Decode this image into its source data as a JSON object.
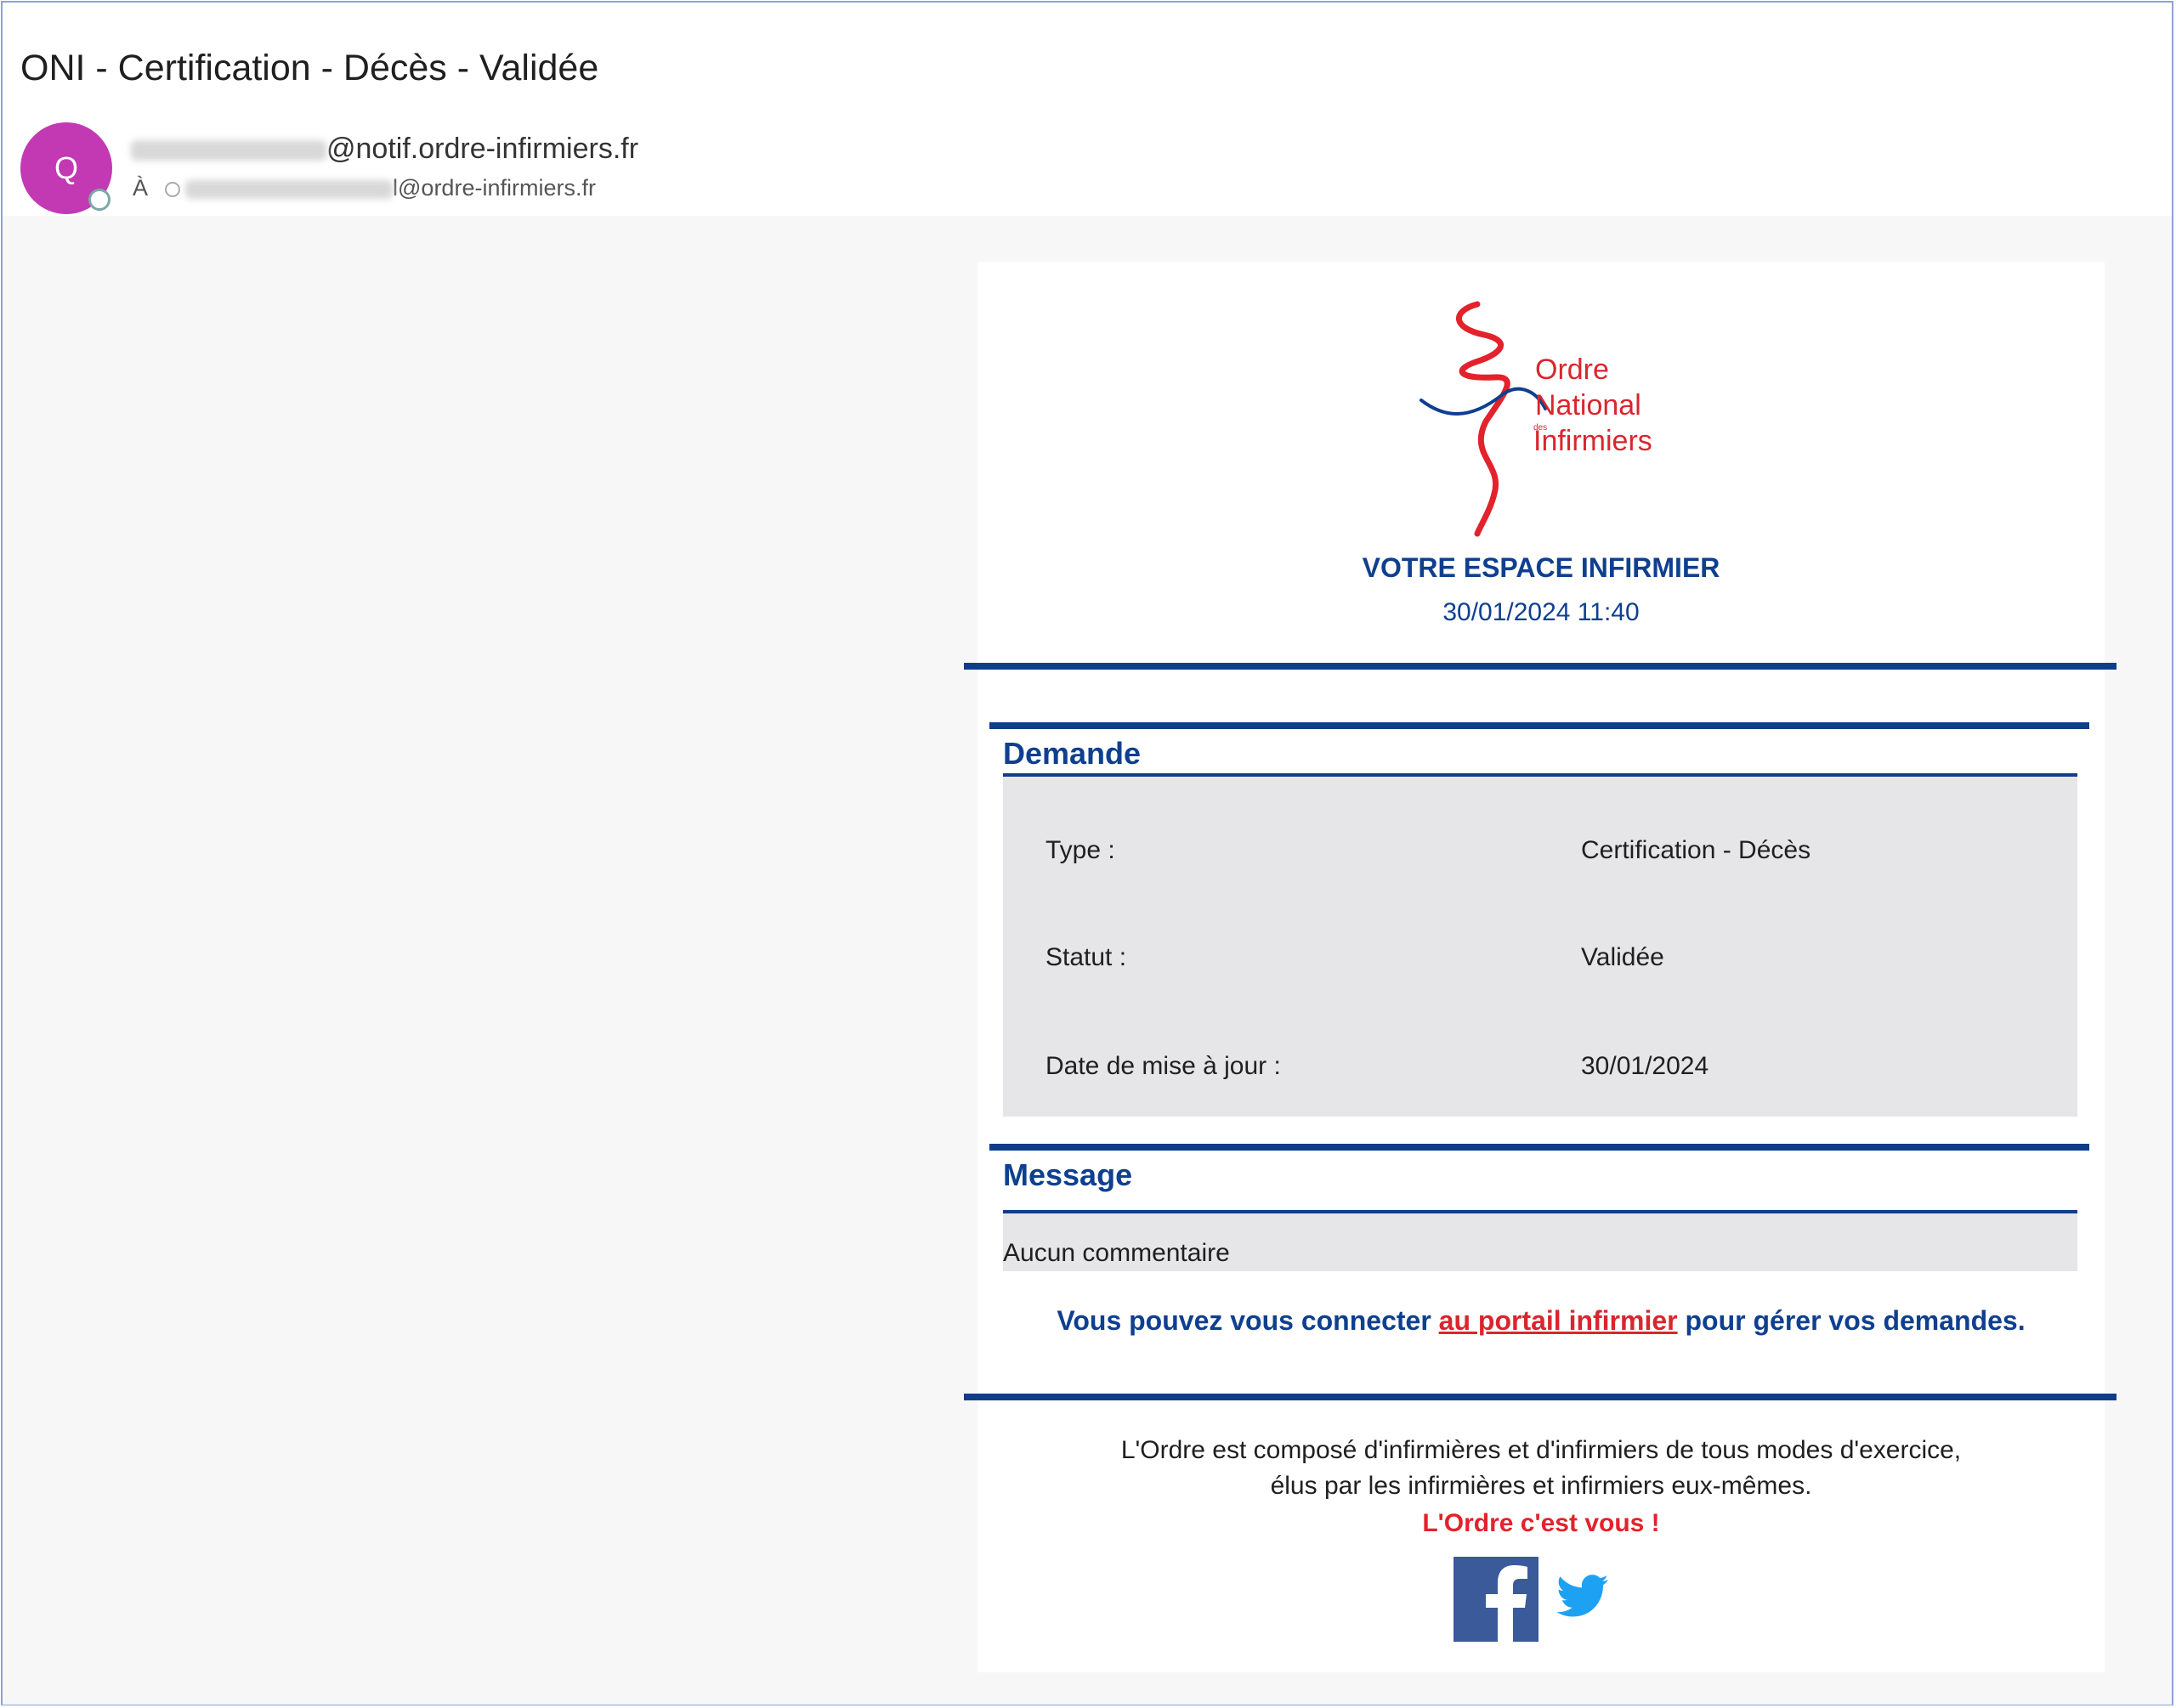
{
  "email": {
    "subject": "ONI - Certification - Décès - Validée",
    "avatar_initial": "Q",
    "sender_domain": "@notif.ordre-infirmiers.fr",
    "to_label": "À",
    "recipient_domain": "l@ordre-infirmiers.fr"
  },
  "header": {
    "logo_text": [
      "Ordre",
      "National",
      "des",
      "Infirmiers"
    ],
    "espace": "VOTRE ESPACE INFIRMIER",
    "datetime": "30/01/2024 11:40"
  },
  "demande": {
    "title": "Demande",
    "rows": [
      {
        "label": "Type :",
        "value": "Certification - Décès"
      },
      {
        "label": "Statut :",
        "value": "Validée"
      },
      {
        "label": "Date de mise à jour :",
        "value": "30/01/2024"
      }
    ]
  },
  "message": {
    "title": "Message",
    "text": "Aucun commentaire"
  },
  "connect": {
    "before": "Vous pouvez vous connecter ",
    "link": "au portail infirmier",
    "after": " pour gérer vos demandes."
  },
  "footer": {
    "line1": "L'Ordre est composé d'infirmières et d'infirmiers de tous modes d'exercice,",
    "line2": "élus par les infirmières et infirmiers eux-mêmes.",
    "tagline": "L'Ordre c'est vous !"
  },
  "colors": {
    "brand_blue": "#0f3f8f",
    "brand_red": "#e3222c",
    "avatar": "#c239b3"
  },
  "icons": [
    "facebook-icon",
    "twitter-icon"
  ]
}
